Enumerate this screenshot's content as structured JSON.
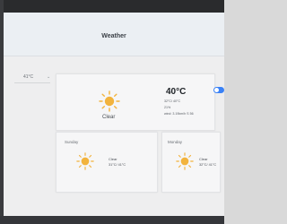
{
  "app": {
    "title": "Weather"
  },
  "unit": {
    "value": "41°C"
  },
  "current": {
    "temp": "40°C",
    "condition": "Clear",
    "range": "32°C/ 40°C",
    "humidity": "21%",
    "wind": "wind: 3.19km/h S 56"
  },
  "forecast": [
    {
      "day": "Sunday",
      "condition": "Clear",
      "range": "31°C/ 41°C"
    },
    {
      "day": "Monday",
      "condition": "Clear",
      "range": "32°C/ 41°C"
    }
  ],
  "icons": {
    "sun": "sun-icon",
    "chevron": "chevron-down-icon"
  },
  "colors": {
    "sun": "#f2b33d",
    "toggle_on": "#3b82f6"
  }
}
